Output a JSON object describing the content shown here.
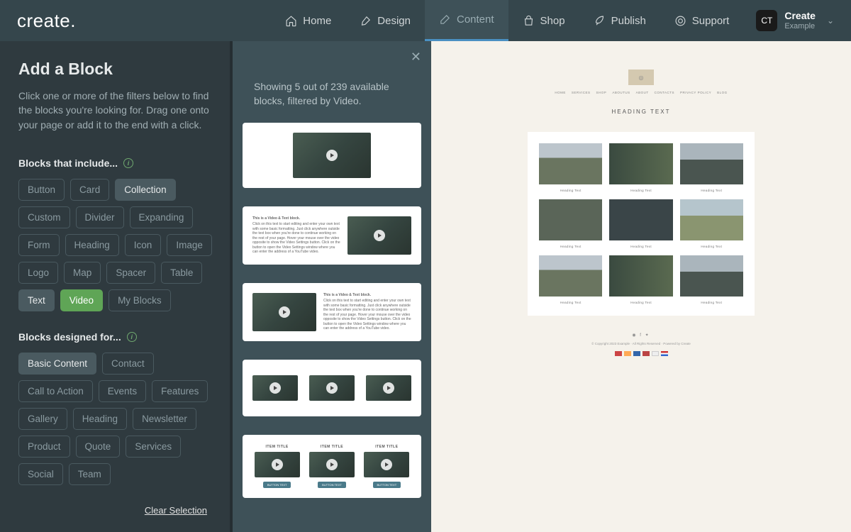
{
  "brand": "create",
  "nav": {
    "items": [
      {
        "label": "Home",
        "icon": "home-icon"
      },
      {
        "label": "Design",
        "icon": "brush-icon"
      },
      {
        "label": "Content",
        "icon": "edit-icon",
        "active": true
      },
      {
        "label": "Shop",
        "icon": "bag-icon"
      },
      {
        "label": "Publish",
        "icon": "rocket-icon"
      },
      {
        "label": "Support",
        "icon": "lifebuoy-icon"
      }
    ],
    "user": {
      "initials": "CT",
      "name": "Create",
      "sub": "Example"
    }
  },
  "sidebar": {
    "title": "Add a Block",
    "desc": "Click one or more of the filters below to find the blocks you're looking for. Drag one onto your page or add it to the end with a click.",
    "section_include": "Blocks that include...",
    "include_tags": [
      {
        "label": "Button"
      },
      {
        "label": "Card"
      },
      {
        "label": "Collection",
        "sel": "gray"
      },
      {
        "label": "Custom"
      },
      {
        "label": "Divider"
      },
      {
        "label": "Expanding"
      },
      {
        "label": "Form"
      },
      {
        "label": "Heading"
      },
      {
        "label": "Icon"
      },
      {
        "label": "Image"
      },
      {
        "label": "Logo"
      },
      {
        "label": "Map"
      },
      {
        "label": "Spacer"
      },
      {
        "label": "Table"
      },
      {
        "label": "Text",
        "sel": "gray"
      },
      {
        "label": "Video",
        "sel": "green"
      },
      {
        "label": "My Blocks"
      }
    ],
    "section_designed": "Blocks designed for...",
    "designed_tags": [
      {
        "label": "Basic Content",
        "sel": "gray"
      },
      {
        "label": "Contact"
      },
      {
        "label": "Call to Action"
      },
      {
        "label": "Events"
      },
      {
        "label": "Features"
      },
      {
        "label": "Gallery"
      },
      {
        "label": "Heading"
      },
      {
        "label": "Newsletter"
      },
      {
        "label": "Product"
      },
      {
        "label": "Quote"
      },
      {
        "label": "Services"
      },
      {
        "label": "Social"
      },
      {
        "label": "Team"
      }
    ],
    "clear": "Clear Selection"
  },
  "results": {
    "showing": "Showing 5 out of 239 available blocks, filtered by Video.",
    "block_sample_title": "This is a Video & Text block.",
    "block_sample_text": "Click on this text to start editing and enter your own text with some basic formatting. Just click anywhere outside the text box when you're done to continue working on the rest of your page. Hover your mouse over the video opposite to show the Video Settings button. Click on the button to open the Video Settings window where you can enter the address of a YouTube video.",
    "item_title": "ITEM TITLE",
    "button_text": "BUTTON TEXT"
  },
  "preview": {
    "nav_items": [
      "HOME",
      "SERVICES",
      "SHOP",
      "ABOUTUS",
      "ABOUT",
      "CONTACTS",
      "PRIVACY POLICY",
      "BLOG"
    ],
    "heading": "HEADING TEXT",
    "caption": "Heading Text",
    "footer": "© Copyright 2023 Example · All Rights Reserved · Powered by Create"
  }
}
